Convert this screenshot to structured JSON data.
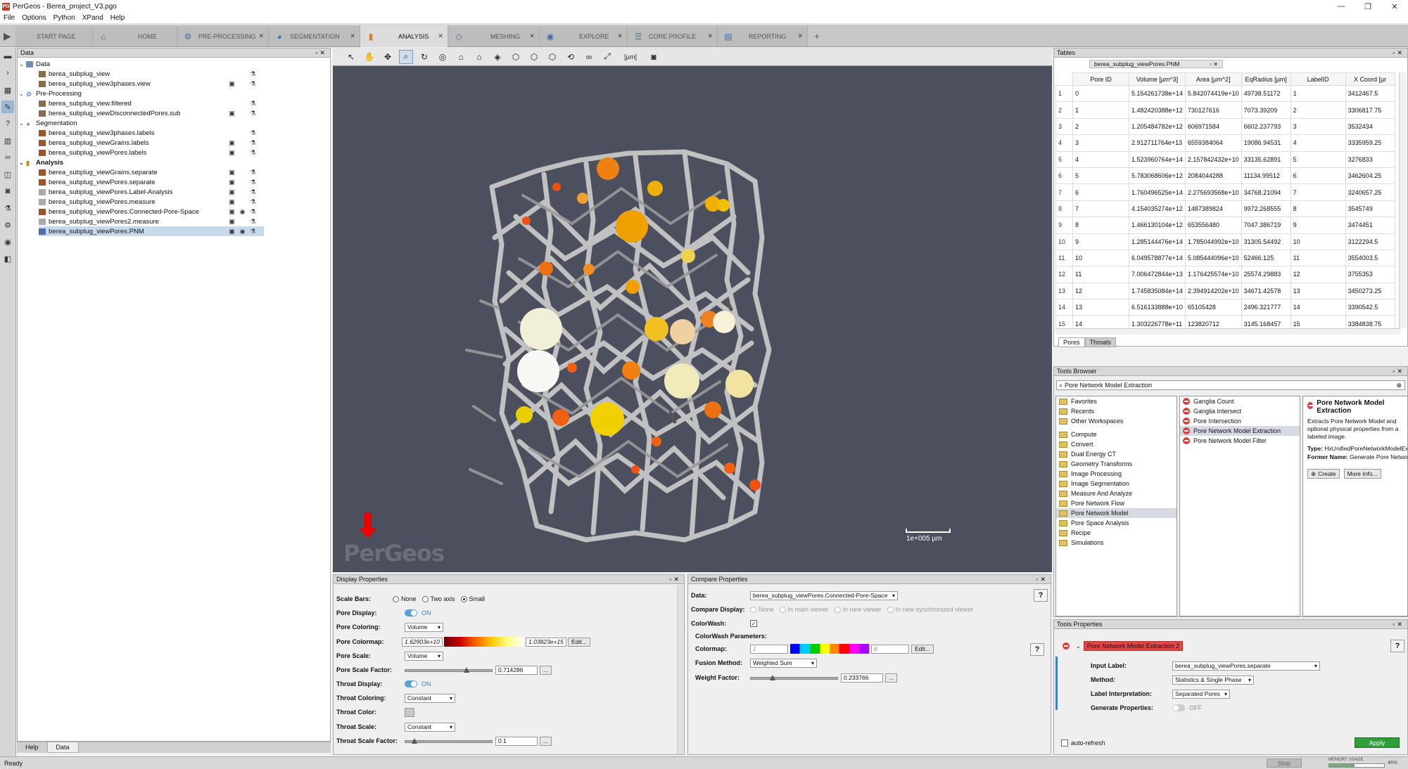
{
  "window": {
    "title": "PerGeos - Berea_project_V3.pgo",
    "min": "—",
    "max": "❐",
    "close": "✕"
  },
  "menu": [
    "File",
    "Options",
    "Python",
    "XPand",
    "Help"
  ],
  "workspace_tabs": [
    {
      "label": "START PAGE"
    },
    {
      "label": "HOME"
    },
    {
      "label": "PRE-PROCESSING"
    },
    {
      "label": "SEGMENTATION"
    },
    {
      "label": "ANALYSIS"
    },
    {
      "label": "MESHING"
    },
    {
      "label": "EXPLORE"
    },
    {
      "label": "CORE PROFILE"
    },
    {
      "label": "REPORTING"
    }
  ],
  "data_panel": {
    "title": "Data",
    "groups": {
      "data": "Data",
      "preprocessing": "Pre-Processing",
      "segmentation": "Segmentation",
      "analysis": "Analysis"
    },
    "items": [
      "berea_subplug_view",
      "berea_subplug_view3phases.view",
      "berea_subplug_view.filtered",
      "berea_subplug_viewDisconnectedPores.sub",
      "berea_subplug_view3phases.labels",
      "berea_subplug_viewGrains.labels",
      "berea_subplug_viewPores.labels",
      "berea_subplug_viewGrains.separate",
      "berea_subplug_viewPores.separate",
      "berea_subplug_viewPores.Label-Analysis",
      "berea_subplug_viewPores.measure",
      "berea_subplug_viewPores.Connected-Pore-Space",
      "berea_subplug_viewPores2.measure",
      "berea_subplug_viewPores.PNM"
    ],
    "bottom_tabs": [
      "Help",
      "Data"
    ]
  },
  "viewer": {
    "unit_label": "[µm]",
    "scale_label": "1e+005 µm",
    "logo": "PerGeos"
  },
  "display_properties": {
    "title": "Display Properties",
    "scale_bars_label": "Scale Bars:",
    "scale_bars_options": [
      "None",
      "Two axis",
      "Small"
    ],
    "pore_display_label": "Pore Display:",
    "on": "ON",
    "pore_coloring_label": "Pore Coloring:",
    "pore_coloring": "Volume",
    "pore_colormap_label": "Pore Colormap:",
    "colormap_min": "1.62903e+10",
    "colormap_max": "1.03823e+15",
    "edit": "Edit...",
    "pore_scale_label": "Pore Scale:",
    "pore_scale": "Volume",
    "pore_scale_factor_label": "Pore Scale Factor:",
    "pore_scale_factor": "0.714286",
    "more": "...",
    "throat_display_label": "Throat Display:",
    "throat_coloring_label": "Throat Coloring:",
    "throat_coloring": "Constant",
    "throat_color_label": "Throat Color:",
    "throat_scale_label": "Throat Scale:",
    "throat_scale": "Constant",
    "throat_scale_factor_label": "Throat Scale Factor:",
    "throat_scale_factor": "0.1"
  },
  "compare_properties": {
    "title": "Compare Properties",
    "data_label": "Data:",
    "data_value": "berea_subplug_viewPores.Connected-Pore-Space",
    "compare_display_label": "Compare Display:",
    "compare_options": [
      "None",
      "In main viewer",
      "In new viewer",
      "In new synchronized viewer"
    ],
    "colorwash_label": "ColorWash:",
    "colorwash_params": "ColorWash Parameters:",
    "colormap_label": "Colormap:",
    "colormap_min": "1",
    "colormap_max": "8",
    "edit": "Edit...",
    "fusion_label": "Fusion Method:",
    "fusion_value": "Weighted Sum",
    "weight_label": "Weight Factor:",
    "weight_value": "0.233766",
    "more": "..."
  },
  "tables": {
    "title": "Tables",
    "tab": "berea_subplug_viewPores.PNM",
    "columns": [
      "Pore ID",
      "Volume [µm^3]",
      "Area [µm^2]",
      "EqRadius [µm]",
      "LabelID",
      "X Coord [µr"
    ],
    "rows": [
      [
        "1",
        "0",
        "5.154261738e+14",
        "5.842074419e+10",
        "49738.51172",
        "1",
        "3412467.5"
      ],
      [
        "2",
        "1",
        "1.482420388e+12",
        "730127616",
        "7073.39209",
        "2",
        "3306817.75"
      ],
      [
        "3",
        "2",
        "1.205484782e+12",
        "606971584",
        "6602.237793",
        "3",
        "3532434"
      ],
      [
        "4",
        "3",
        "2.912711764e+13",
        "6559384064",
        "19086.94531",
        "4",
        "3335959.25"
      ],
      [
        "5",
        "4",
        "1.523960764e+14",
        "2.157842432e+10",
        "33135.62891",
        "5",
        "3276833"
      ],
      [
        "6",
        "5",
        "5.783068606e+12",
        "2084044288",
        "11134.99512",
        "6",
        "3462604.25"
      ],
      [
        "7",
        "6",
        "1.760496525e+14",
        "2.275693568e+10",
        "34768.21094",
        "7",
        "3240657.25"
      ],
      [
        "8",
        "7",
        "4.154035274e+12",
        "1487389824",
        "9972.268555",
        "8",
        "3545749"
      ],
      [
        "9",
        "8",
        "1.466130104e+12",
        "653556480",
        "7047.386719",
        "9",
        "3474451"
      ],
      [
        "10",
        "9",
        "1.285144476e+14",
        "1.785044992e+10",
        "31305.54492",
        "10",
        "3122294.5"
      ],
      [
        "11",
        "10",
        "6.049578877e+14",
        "5.085444096e+10",
        "52466.125",
        "11",
        "3554003.5"
      ],
      [
        "12",
        "11",
        "7.006472844e+13",
        "1.176425574e+10",
        "25574.29883",
        "12",
        "3755353"
      ],
      [
        "13",
        "12",
        "1.745835084e+14",
        "2.394914202e+10",
        "34671.42578",
        "13",
        "3450273.25"
      ],
      [
        "14",
        "13",
        "6.516133888e+10",
        "65105428",
        "2496.321777",
        "14",
        "3390542.5"
      ],
      [
        "15",
        "14",
        "1.303226778e+11",
        "123820712",
        "3145.168457",
        "15",
        "3384838.75"
      ]
    ],
    "bottom_tabs": [
      "Pores",
      "Throats"
    ]
  },
  "tools_browser": {
    "title": "Tools Browser",
    "search": "Pore Network Model Extraction",
    "categories": [
      "Favorites",
      "Recents",
      "Other Workspaces",
      "Compute",
      "Convert",
      "Dual Energy CT",
      "Geometry Transforms",
      "Image Processing",
      "Image Segmentation",
      "Measure And Analyze",
      "Pore Network Flow",
      "Pore Network Model",
      "Pore Space Analysis",
      "Recipe",
      "Simulations"
    ],
    "tools": [
      "Ganglia Count",
      "Ganglia Intersect",
      "Pore Intersection",
      "Pore Network Model Extraction",
      "Pore Network Model Filter"
    ],
    "desc_title": "Pore Network Model Extraction",
    "desc_text": "Extracts Pore Network Model and optional physical properties from a labeled image.",
    "type_label": "Type:",
    "type_value": "HxUnifiedPoreNetworkModelEx...",
    "former_label": "Former Name:",
    "former_value": "Generate Pore Network",
    "create": "Create",
    "more_info": "More Info..."
  },
  "tools_properties": {
    "title": "Tools Properties",
    "module": "Pore Network Model Extraction 2",
    "input_label": "Input Label:",
    "input_value": "berea_subplug_viewPores.separate",
    "method_label": "Method:",
    "method_value": "Statistics & Single Phase",
    "interp_label": "Label Interpretation:",
    "interp_value": "Separated Pores",
    "gen_label": "Generate Properties:",
    "off": "OFF",
    "auto_refresh": "auto-refresh",
    "apply": "Apply"
  },
  "status": {
    "text": "Ready",
    "stop": "Stop",
    "memory": "MEMORY USAGE",
    "mem_pct": "46%"
  },
  "colors": {
    "accent": "#5aa0d8",
    "viewer_bg": "#4b4f5e",
    "apply": "#2f9e3a",
    "module": "#e04848"
  }
}
